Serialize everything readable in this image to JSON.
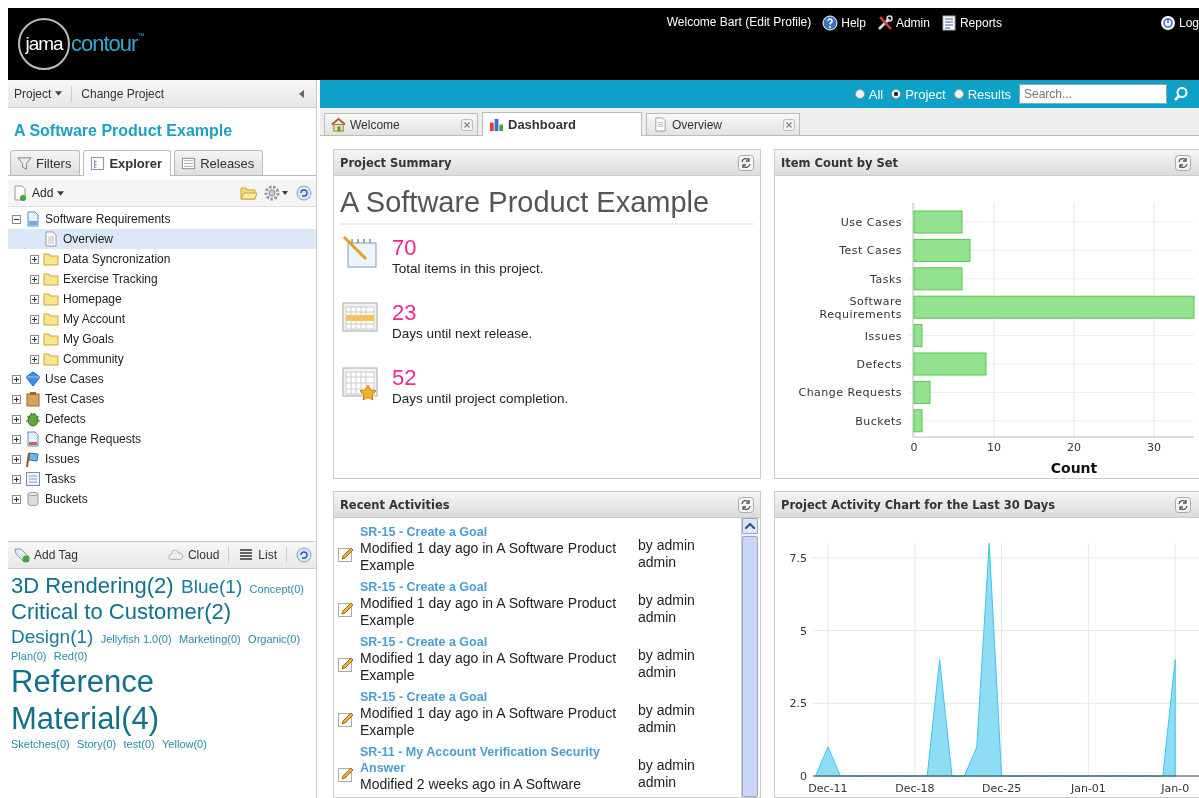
{
  "header": {
    "logo": {
      "name": "jama",
      "product": "contour",
      "mark": "™"
    },
    "nav": [
      {
        "kind": "text",
        "label": "Welcome Bart (Edit Profile)"
      },
      {
        "kind": "help",
        "label": "Help"
      },
      {
        "kind": "admin",
        "label": "Admin"
      },
      {
        "kind": "reports",
        "label": "Reports"
      },
      {
        "kind": "logout",
        "label": "Log"
      }
    ]
  },
  "project_bar": {
    "menu": "Project",
    "link": "Change Project"
  },
  "project_title": "A Software Product Example",
  "left_tabs": [
    {
      "label": "Filters",
      "kind": "filter",
      "selected": false
    },
    {
      "label": "Explorer",
      "kind": "explorer",
      "selected": true
    },
    {
      "label": "Releases",
      "kind": "releases",
      "selected": false
    }
  ],
  "explorer_toolbar": {
    "add": "Add"
  },
  "tree": [
    {
      "label": "Software Requirements",
      "kind": "requirements",
      "expanded": true,
      "selected": false,
      "children": [
        {
          "label": "Overview",
          "kind": "page",
          "selected": true
        },
        {
          "label": "Data Syncronization",
          "kind": "folder",
          "expanded": false,
          "selected": false
        },
        {
          "label": "Exercise Tracking",
          "kind": "folder",
          "expanded": false,
          "selected": false
        },
        {
          "label": "Homepage",
          "kind": "folder",
          "expanded": false,
          "selected": false
        },
        {
          "label": "My Account",
          "kind": "folder",
          "expanded": false,
          "selected": false
        },
        {
          "label": "My Goals",
          "kind": "folder",
          "expanded": false,
          "selected": false
        },
        {
          "label": "Community",
          "kind": "folder",
          "expanded": false,
          "selected": false
        }
      ]
    },
    {
      "label": "Use Cases",
      "kind": "usecases",
      "expanded": false,
      "selected": false
    },
    {
      "label": "Test Cases",
      "kind": "testcases",
      "expanded": false,
      "selected": false
    },
    {
      "label": "Defects",
      "kind": "defects",
      "expanded": false,
      "selected": false
    },
    {
      "label": "Change Requests",
      "kind": "changes",
      "expanded": false,
      "selected": false
    },
    {
      "label": "Issues",
      "kind": "issues",
      "expanded": false,
      "selected": false
    },
    {
      "label": "Tasks",
      "kind": "tasks",
      "expanded": false,
      "selected": false
    },
    {
      "label": "Buckets",
      "kind": "buckets",
      "expanded": false,
      "selected": false
    }
  ],
  "tag_toolbar": {
    "add": "Add Tag",
    "cloud": "Cloud",
    "list": "List"
  },
  "tags": [
    {
      "label": "3D Rendering(2)",
      "kind": "large"
    },
    {
      "label": "Blue(1)",
      "kind": "medium"
    },
    {
      "label": "Concept(0)",
      "kind": "small"
    },
    {
      "label": "Critical to Customer(2)",
      "kind": "large"
    },
    {
      "label": "Design(1)",
      "kind": "medium"
    },
    {
      "label": "Jellyfish 1.0(0)",
      "kind": "small"
    },
    {
      "label": "Marketing(0)",
      "kind": "small"
    },
    {
      "label": "Organic(0)",
      "kind": "small"
    },
    {
      "label": "Plan(0)",
      "kind": "small"
    },
    {
      "label": "Red(0)",
      "kind": "small"
    },
    {
      "label": "Reference Material(4)",
      "kind": "xlarge"
    },
    {
      "label": "Sketches(0)",
      "kind": "small"
    },
    {
      "label": "Story(0)",
      "kind": "small"
    },
    {
      "label": "test(0)",
      "kind": "small"
    },
    {
      "label": "Yellow(0)",
      "kind": "small"
    }
  ],
  "scope": [
    {
      "label": "All",
      "selected": false
    },
    {
      "label": "Project",
      "selected": true
    },
    {
      "label": "Results",
      "selected": false
    }
  ],
  "search": {
    "placeholder": "Search..."
  },
  "main_tabs": [
    {
      "label": "Welcome",
      "kind": "home",
      "selected": false,
      "closable": true
    },
    {
      "label": "Dashboard",
      "kind": "chart",
      "selected": true,
      "closable": false
    },
    {
      "label": "Overview",
      "kind": "page",
      "selected": false,
      "closable": true
    }
  ],
  "project_summary": {
    "title": "Project Summary",
    "heading": "A Software Product Example",
    "stats": [
      {
        "kind": "items",
        "value": "70",
        "text": "Total items in this project."
      },
      {
        "kind": "release",
        "value": "23",
        "text": "Days until next release."
      },
      {
        "kind": "completion",
        "value": "52",
        "text": "Days until project completion."
      }
    ]
  },
  "item_count": {
    "title": "Item Count by Set",
    "chart_data": {
      "type": "bar",
      "orientation": "horizontal",
      "xlabel": "Count",
      "categories": [
        "Use Cases",
        "Test Cases",
        "Tasks",
        "Software Requirements",
        "Issues",
        "Defects",
        "Change Requests",
        "Buckets"
      ],
      "values": [
        6,
        7,
        6,
        35,
        1,
        9,
        2,
        1
      ],
      "xlim": [
        0,
        35
      ],
      "grid": true,
      "xticks": [
        0,
        10,
        20,
        30
      ]
    }
  },
  "recent_activities": {
    "title": "Recent Activities",
    "items": [
      {
        "link": "SR-15 - Create a Goal",
        "text": "Modified 1 day ago in A Software Product Example",
        "author": "by admin admin"
      },
      {
        "link": "SR-15 - Create a Goal",
        "text": "Modified 1 day ago in A Software Product Example",
        "author": "by admin admin"
      },
      {
        "link": "SR-15 - Create a Goal",
        "text": "Modified 1 day ago in A Software Product Example",
        "author": "by admin admin"
      },
      {
        "link": "SR-15 - Create a Goal",
        "text": "Modified 1 day ago in A Software Product Example",
        "author": "by admin admin"
      },
      {
        "link": "SR-11 - My Account Verification Security Answer",
        "text": "Modified 2 weeks ago in A Software",
        "author": "by admin admin"
      }
    ]
  },
  "activity_chart": {
    "title": "Project Activity Chart for the Last 30 Days",
    "chart_data": {
      "type": "area",
      "categories": [
        null,
        "Dec-11",
        null,
        null,
        null,
        null,
        null,
        null,
        "Dec-18",
        null,
        null,
        null,
        null,
        null,
        null,
        "Dec-25",
        null,
        null,
        null,
        null,
        null,
        null,
        "Jan-01",
        null,
        null,
        null,
        null,
        null,
        null,
        "Jan-0"
      ],
      "values": [
        0,
        1,
        0,
        0,
        0,
        0,
        0,
        0,
        0,
        0,
        4,
        0,
        0,
        1,
        8,
        0,
        0,
        0,
        0,
        0,
        0,
        0,
        0,
        0,
        0,
        0,
        0,
        0,
        0,
        4
      ],
      "grid": true,
      "ylim": [
        0,
        8
      ],
      "yticks": [
        0,
        2.5,
        5,
        7.5
      ]
    }
  }
}
